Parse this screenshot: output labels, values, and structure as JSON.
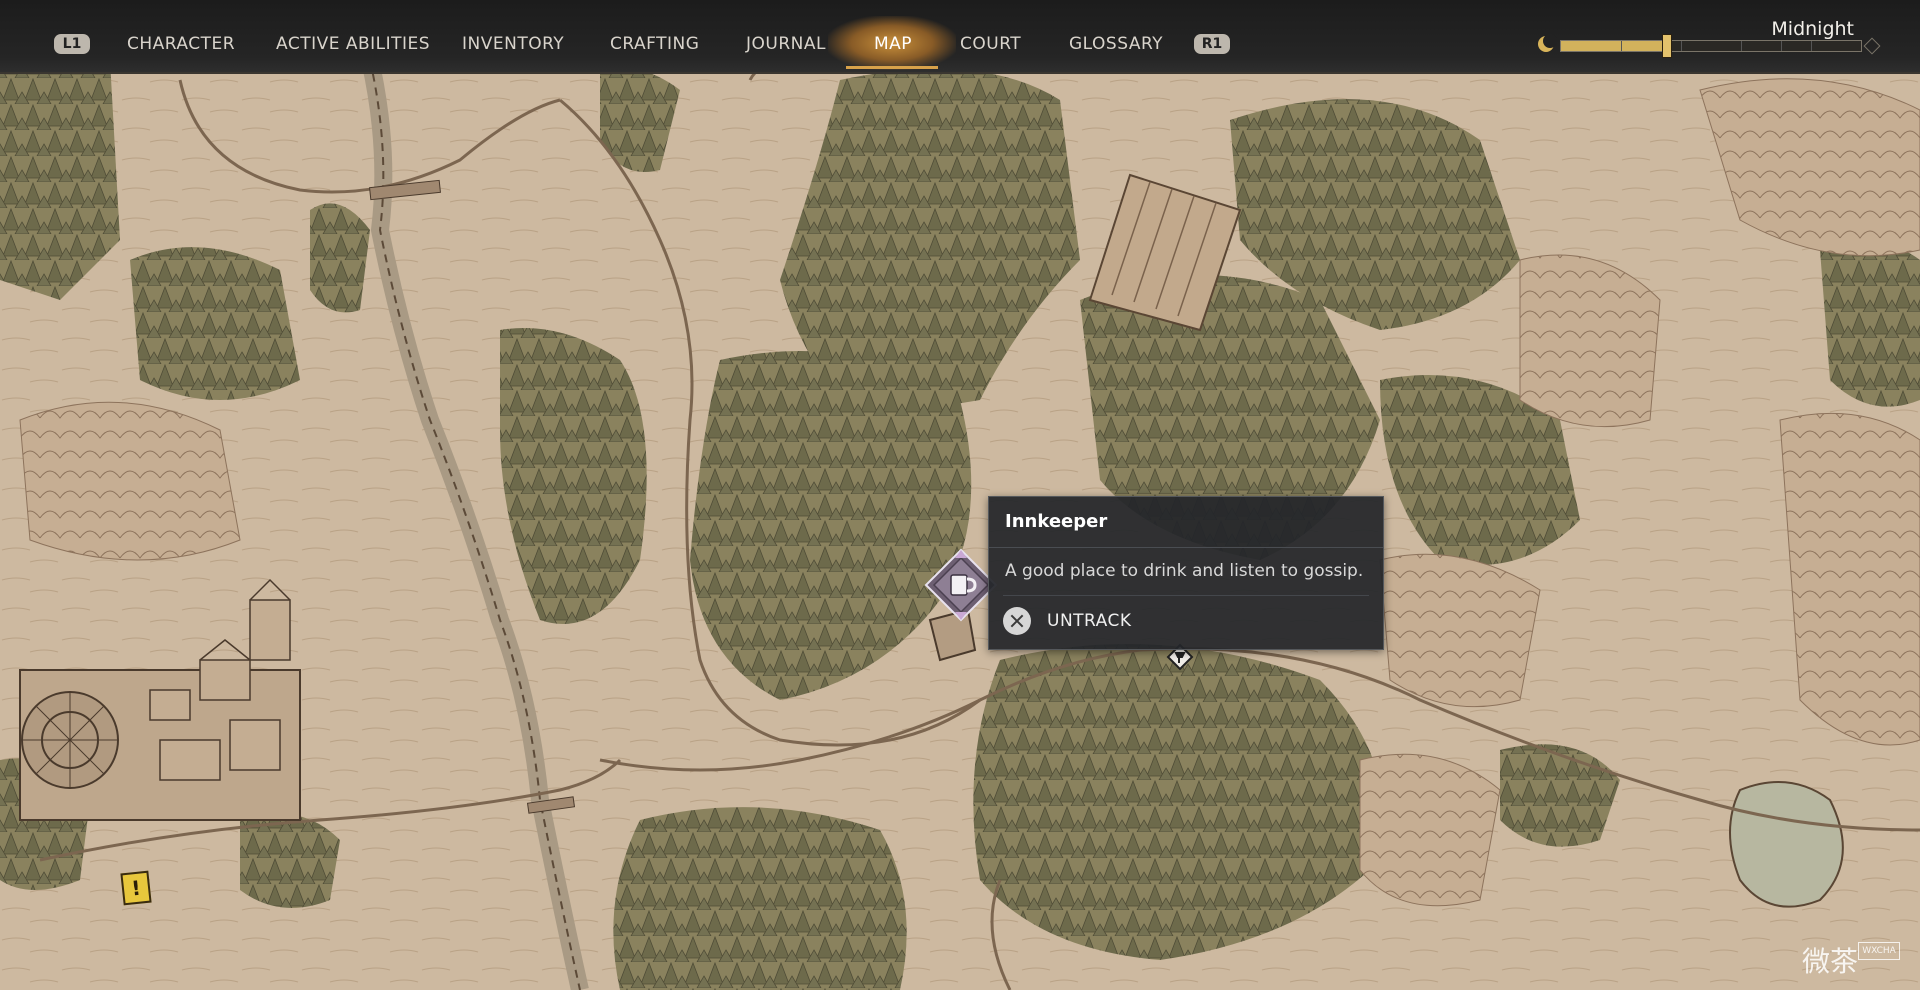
{
  "colors": {
    "parchment": "#cdb9a0",
    "forest": "#6e6a4e",
    "ink": "#4a3a2c",
    "accent": "#d8a24a",
    "topbar": "#222222"
  },
  "topbar": {
    "left_shoulder": "L1",
    "right_shoulder": "R1",
    "tabs": [
      {
        "label": "CHARACTER"
      },
      {
        "label": "ACTIVE ABILITIES"
      },
      {
        "label": "INVENTORY"
      },
      {
        "label": "CRAFTING"
      },
      {
        "label": "JOURNAL"
      },
      {
        "label": "MAP",
        "active": true
      },
      {
        "label": "COURT"
      },
      {
        "label": "GLOSSARY"
      }
    ],
    "time_of_day": "Midnight",
    "time_progress": 0.35
  },
  "tooltip": {
    "title": "Innkeeper",
    "description": "A good place to drink and listen to gossip.",
    "action_label": "UNTRACK",
    "action_icon": "cross-button-icon"
  },
  "markers": {
    "quest_symbol": "!",
    "inn_icon": "tankard-icon"
  },
  "watermark": {
    "text": "微茶",
    "badge": "WXCHA"
  }
}
